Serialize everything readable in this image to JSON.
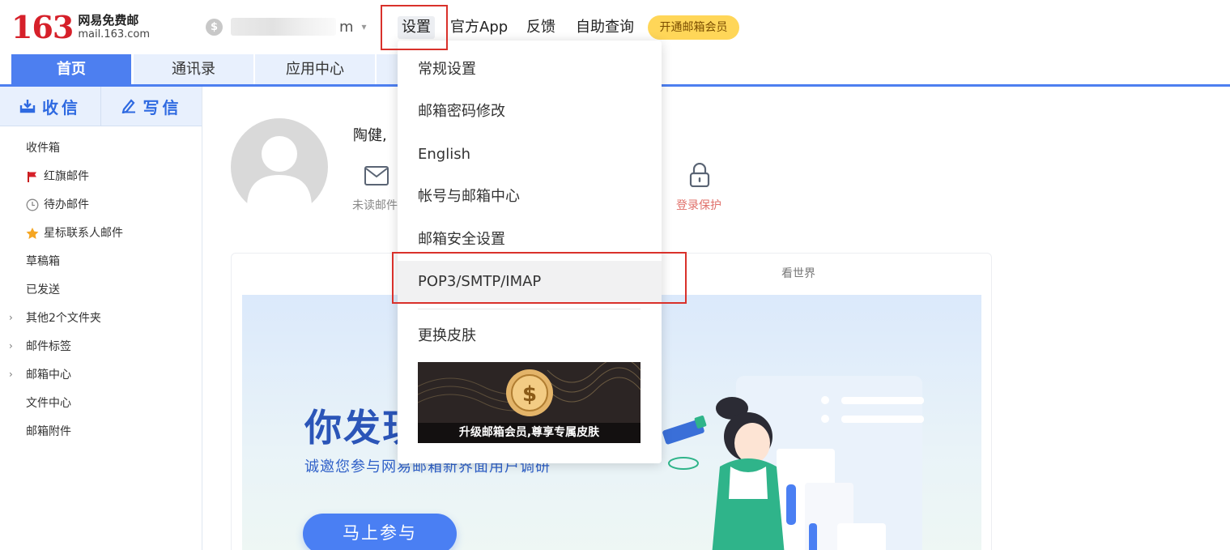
{
  "header": {
    "logo_number": "163",
    "logo_cn": "网易免费邮",
    "logo_domain": "mail.163.com",
    "account_suffix": "m",
    "nav": {
      "settings": "设置",
      "official_app": "官方App",
      "feedback": "反馈",
      "self_service": "自助查询"
    },
    "vip_button": "开通邮箱会员"
  },
  "tabs": [
    {
      "label": "首页",
      "active": true
    },
    {
      "label": "通讯录",
      "active": false
    },
    {
      "label": "应用中心",
      "active": false
    }
  ],
  "sidebar": {
    "receive_label": "收信",
    "compose_label": "写信",
    "folders": [
      {
        "label": "收件箱",
        "icon": ""
      },
      {
        "label": "红旗邮件",
        "icon": "red-flag-icon"
      },
      {
        "label": "待办邮件",
        "icon": "clock-icon"
      },
      {
        "label": "星标联系人邮件",
        "icon": "star-icon"
      },
      {
        "label": "草稿箱",
        "icon": ""
      },
      {
        "label": "已发送",
        "icon": ""
      },
      {
        "label": "其他2个文件夹",
        "icon": "",
        "expandable": true
      },
      {
        "label": "邮件标签",
        "icon": "",
        "expandable": true
      },
      {
        "label": "邮箱中心",
        "icon": "",
        "expandable": true
      },
      {
        "label": "文件中心",
        "icon": ""
      },
      {
        "label": "邮箱附件",
        "icon": ""
      }
    ]
  },
  "main": {
    "greeting": "陶健,",
    "unread_label": "未读邮件",
    "login_protect_label": "登录保护",
    "see_world_tab": "看世界",
    "banner": {
      "headline": "你发现",
      "subtitle": "诚邀您参与网易邮箱新界面用户调研",
      "button": "马上参与"
    }
  },
  "settings_menu": {
    "items": [
      {
        "label": "常规设置",
        "highlighted": false
      },
      {
        "label": "邮箱密码修改",
        "highlighted": false
      },
      {
        "label": "English",
        "highlighted": false
      },
      {
        "label": "帐号与邮箱中心",
        "highlighted": false
      },
      {
        "label": "邮箱安全设置",
        "highlighted": false
      },
      {
        "label": "POP3/SMTP/IMAP",
        "highlighted": true
      },
      {
        "label": "更换皮肤",
        "highlighted": false
      }
    ],
    "promo_caption": "升级邮箱会员,尊享专属皮肤"
  },
  "colors": {
    "brand_red": "#d6202a",
    "accent_blue": "#4d7ff0",
    "vip_yellow": "#ffd658",
    "annotation_red": "#d9312b"
  }
}
